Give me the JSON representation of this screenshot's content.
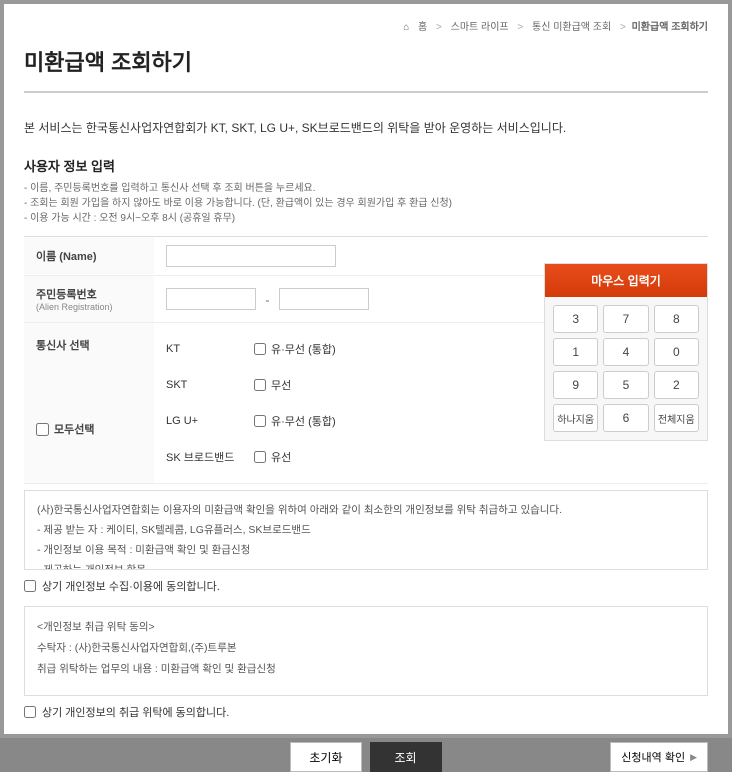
{
  "breadcrumb": {
    "home_icon": "⌂",
    "home": "홈",
    "l1": "스마트 라이프",
    "l2": "통신 미환급액 조회",
    "l3": "미환급액 조회하기",
    "sep": ">"
  },
  "title": "미환급액 조회하기",
  "service_desc": "본 서비스는 한국통신사업자연합회가 KT, SKT, LG U+, SK브로드밴드의 위탁을 받아 운영하는 서비스입니다.",
  "section_title": "사용자 정보 입력",
  "notes": {
    "n1": "- 이름, 주민등록번호를 입력하고 통신사 선택 후 조회 버튼을 누르세요.",
    "n2": "- 조회는 회원 가입을 하지 않아도 바로 이용 가능합니다. (단, 환급액이 있는 경우 회원가입 후 환급 신청)",
    "n3": "- 이용 가능 시간 : 오전 9시~오후 8시 (공휴일 휴무)"
  },
  "form": {
    "name_label": "이름 (Name)",
    "rrn_label": "주민등록번호",
    "rrn_sub": "(Alien Registration)",
    "rrn_dash": "-",
    "carrier_label": "통신사 선택",
    "select_all": "모두선택",
    "carriers": {
      "kt": {
        "name": "KT",
        "opt": "유·무선 (통합)"
      },
      "skt": {
        "name": "SKT",
        "opt": "무선"
      },
      "lgu": {
        "name": "LG U+",
        "opt": "유·무선 (통합)"
      },
      "skb": {
        "name": "SK 브로드밴드",
        "opt": "유선"
      }
    }
  },
  "keypad": {
    "title": "마우스 입력기",
    "keys": [
      "3",
      "7",
      "8",
      "1",
      "4",
      "0",
      "9",
      "5",
      "2"
    ],
    "back": "하나지움",
    "six": "6",
    "clear": "전체지움"
  },
  "consent1": {
    "p1": "(사)한국통신사업자연합회는 이용자의 미환급액 확인을 위하여 아래와 같이 최소한의 개인정보를 위탁 취급하고 있습니다.",
    "p2": "- 제공 받는 자 : 케이티, SK텔레콤, LG유플러스, SK브로드밴드",
    "p3": "- 개인정보 이용 목적 : 미환급액 확인 및 환급신청",
    "p4": "- 제공하는 개인정보 항목"
  },
  "consent1_check": "상기 개인정보 수집·이용에 동의합니다.",
  "consent2": {
    "p1": "<개인정보 취급 위탁 동의>",
    "p2": "수탁자 : (사)한국통신사업자연합회,(주)트루본",
    "p3": "취급 위탁하는 업무의 내용 : 미환급액 확인 및 환급신청"
  },
  "consent2_check": "상기 개인정보의 취급 위탁에 동의합니다.",
  "actions": {
    "reset": "초기화",
    "submit": "조회",
    "history": "신청내역 확인",
    "tri": "▶"
  }
}
